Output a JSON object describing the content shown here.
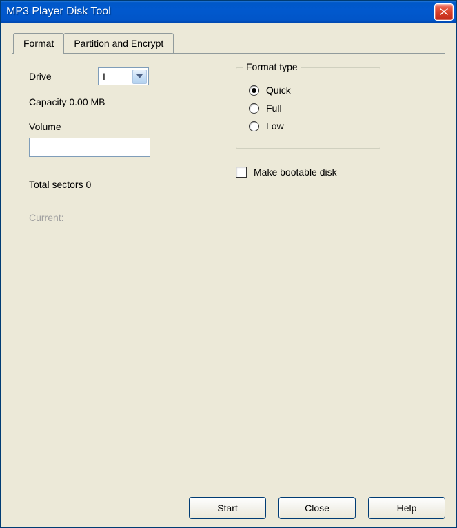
{
  "window": {
    "title": "MP3 Player Disk Tool"
  },
  "tabs": [
    {
      "label": "Format",
      "active": true
    },
    {
      "label": "Partition and Encrypt",
      "active": false
    }
  ],
  "form": {
    "drive_label": "Drive",
    "drive_value": "I",
    "capacity_text": "Capacity 0.00 MB",
    "volume_label": "Volume",
    "volume_value": "",
    "total_sectors_text": "Total sectors 0",
    "current_label": "Current:"
  },
  "format_type": {
    "legend": "Format type",
    "options": [
      {
        "label": "Quick",
        "checked": true
      },
      {
        "label": "Full",
        "checked": false
      },
      {
        "label": "Low",
        "checked": false
      }
    ]
  },
  "bootable": {
    "label": "Make bootable disk",
    "checked": false
  },
  "buttons": {
    "start": "Start",
    "close": "Close",
    "help": "Help"
  }
}
